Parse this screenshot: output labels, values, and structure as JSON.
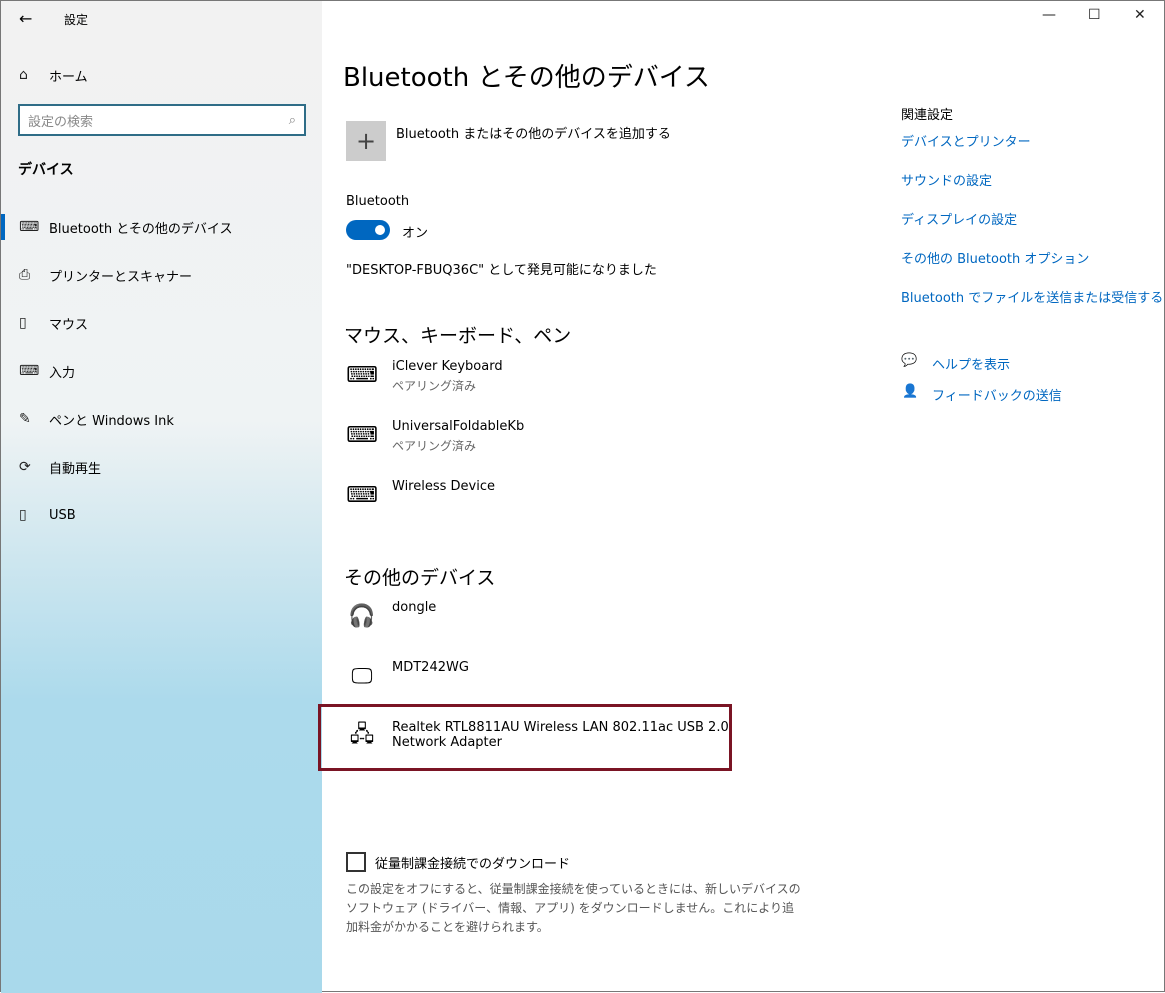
{
  "window": {
    "title": "設定",
    "back": "←",
    "minimize": "—",
    "maximize": "☐",
    "close": "✕"
  },
  "sidebar": {
    "home": "ホーム",
    "search_placeholder": "設定の検索",
    "section": "デバイス",
    "items": [
      {
        "label": "Bluetooth とその他のデバイス",
        "icon": "⌨"
      },
      {
        "label": "プリンターとスキャナー",
        "icon": "⎙"
      },
      {
        "label": "マウス",
        "icon": "▯"
      },
      {
        "label": "入力",
        "icon": "⌨"
      },
      {
        "label": "ペンと Windows Ink",
        "icon": "✎"
      },
      {
        "label": "自動再生",
        "icon": "⟳"
      },
      {
        "label": "USB",
        "icon": "▯"
      }
    ]
  },
  "main": {
    "title": "Bluetooth とその他のデバイス",
    "add_device": "Bluetooth またはその他のデバイスを追加する",
    "bluetooth_label": "Bluetooth",
    "toggle_state": "オン",
    "toggle_on": true,
    "discoverable": "\"DESKTOP-FBUQ36C\" として発見可能になりました",
    "section1": "マウス、キーボード、ペン",
    "input_devices": [
      {
        "name": "iClever Keyboard",
        "status": "ペアリング済み"
      },
      {
        "name": "UniversalFoldableKb",
        "status": "ペアリング済み"
      },
      {
        "name": "Wireless Device",
        "status": ""
      }
    ],
    "section2": "その他のデバイス",
    "other_devices": [
      {
        "name": "dongle"
      },
      {
        "name": "MDT242WG"
      },
      {
        "name": "Realtek RTL8811AU Wireless LAN 802.11ac USB 2.0",
        "name2": "Network Adapter"
      }
    ],
    "metered_label": "従量制課金接続でのダウンロード",
    "metered_checked": false,
    "metered_desc": "この設定をオフにすると、従量制課金接続を使っているときには、新しいデバイスのソフトウェア (ドライバー、情報、アプリ) をダウンロードしません。これにより追加料金がかかることを避けられます。"
  },
  "related": {
    "title": "関連設定",
    "links": [
      "デバイスとプリンター",
      "サウンドの設定",
      "ディスプレイの設定",
      "その他の Bluetooth オプション",
      "Bluetooth でファイルを送信または受信する"
    ],
    "help": "ヘルプを表示",
    "feedback": "フィードバックの送信"
  },
  "colors": {
    "accent": "#0067c0",
    "highlight_border": "#7a1424"
  }
}
